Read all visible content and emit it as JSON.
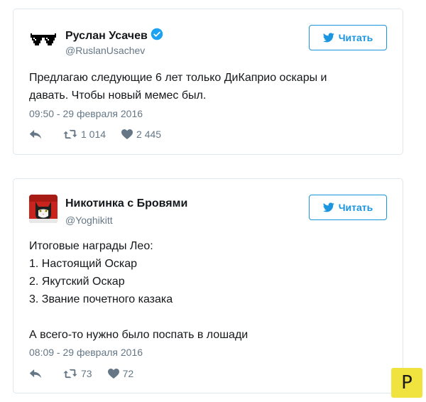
{
  "colors": {
    "accent": "#1b95e0",
    "text": "#14171a",
    "secondary": "#657786",
    "border": "#e1e8ed",
    "verified": "#1da1f2",
    "watermark_bg": "#f0e33f"
  },
  "tweets": [
    {
      "author_name": "Руслан Усачев",
      "handle": "@RuslanUsachev",
      "verified": true,
      "follow_label": "Читать",
      "text_lines": [
        "Предлагаю следующие 6 лет только ДиКаприо оскары и",
        "давать. Чтобы новый мемес был."
      ],
      "timestamp": "09:50 - 29 февраля 2016",
      "retweets": "1 014",
      "likes": "2 445",
      "avatar_icon": "pixel-glasses-icon"
    },
    {
      "author_name": "Никотинка с Бровями",
      "handle": "@Yoghikitt",
      "verified": false,
      "follow_label": "Читать",
      "text_lines": [
        "Итоговые награды Лео:",
        "1. Настоящий Оскар",
        "2. Якутский Оскар",
        "3. Звание почетного казака",
        "",
        "А всего-то нужно было поспать в лошади"
      ],
      "timestamp": "08:09 - 29 февраля 2016",
      "retweets": "73",
      "likes": "72",
      "avatar_icon": "cat-avatar-icon"
    }
  ],
  "watermark": {
    "letter": "P"
  }
}
